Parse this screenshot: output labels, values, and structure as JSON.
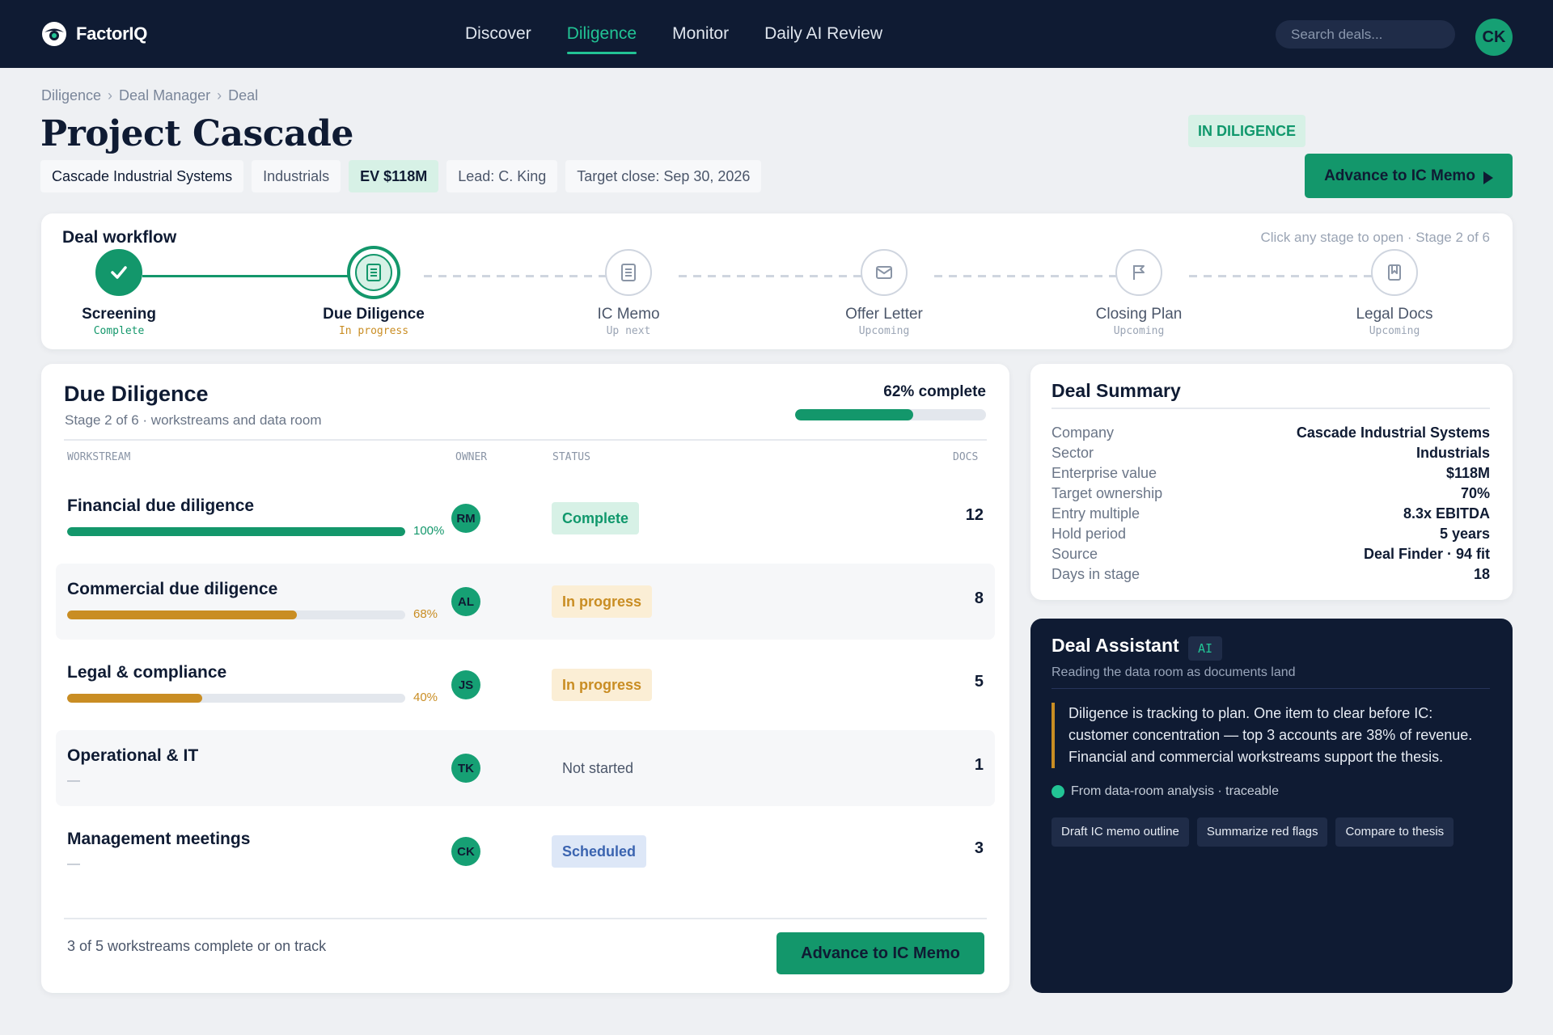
{
  "app": {
    "name": "FactorIQ",
    "nav": [
      "Discover",
      "Diligence",
      "Monitor",
      "Daily AI Review"
    ],
    "search_placeholder": "Search deals...",
    "user_initials": "CK"
  },
  "breadcrumb": [
    "Diligence",
    "Deal Manager",
    "Deal"
  ],
  "deal": {
    "title": "Project Cascade",
    "status": "IN DILIGENCE",
    "company": "Cascade Industrial Systems",
    "sector": "Industrials",
    "ev": "EV $118M",
    "lead": "Lead: C. King",
    "target_close": "Target close: Sep 30, 2026",
    "advance_label": "Advance to IC Memo"
  },
  "workflow": {
    "title": "Deal workflow",
    "hint": "Click any stage to open · Stage 2 of 6",
    "stages": [
      {
        "name": "Screening",
        "status": "Complete",
        "icon": "check-icon"
      },
      {
        "name": "Due Diligence",
        "status": "In progress",
        "icon": "document-icon"
      },
      {
        "name": "IC Memo",
        "status": "Up next",
        "icon": "document-icon"
      },
      {
        "name": "Offer Letter",
        "status": "Upcoming",
        "icon": "envelope-icon"
      },
      {
        "name": "Closing Plan",
        "status": "Upcoming",
        "icon": "flag-icon"
      },
      {
        "name": "Legal Docs",
        "status": "Upcoming",
        "icon": "bookmark-icon"
      }
    ]
  },
  "due_diligence": {
    "title": "Due Diligence",
    "subtitle": "Stage 2 of 6 · workstreams and data room",
    "percent_label": "62% complete",
    "percent": 62,
    "columns": {
      "workstream": "WORKSTREAM",
      "owner": "OWNER",
      "status": "STATUS",
      "docs": "DOCS"
    },
    "rows": [
      {
        "name": "Financial due diligence",
        "progress": 100,
        "progress_label": "100%",
        "owner": "RM",
        "status": "Complete",
        "docs": "12"
      },
      {
        "name": "Commercial due diligence",
        "progress": 68,
        "progress_label": "68%",
        "owner": "AL",
        "status": "In progress",
        "docs": "8"
      },
      {
        "name": "Legal & compliance",
        "progress": 40,
        "progress_label": "40%",
        "owner": "JS",
        "status": "In progress",
        "docs": "5"
      },
      {
        "name": "Operational & IT",
        "progress": null,
        "progress_label": "—",
        "owner": "TK",
        "status": "Not started",
        "docs": "1"
      },
      {
        "name": "Management meetings",
        "progress": null,
        "progress_label": "—",
        "owner": "CK",
        "status": "Scheduled",
        "docs": "3"
      }
    ],
    "footer": "3 of 5 workstreams complete or on track",
    "advance_label": "Advance to IC Memo"
  },
  "summary": {
    "title": "Deal Summary",
    "rows": [
      {
        "label": "Company",
        "value": "Cascade Industrial Systems"
      },
      {
        "label": "Sector",
        "value": "Industrials"
      },
      {
        "label": "Enterprise value",
        "value": "$118M"
      },
      {
        "label": "Target ownership",
        "value": "70%"
      },
      {
        "label": "Entry multiple",
        "value": "8.3x EBITDA"
      },
      {
        "label": "Hold period",
        "value": "5 years"
      },
      {
        "label": "Source",
        "value": "Deal Finder · 94 fit"
      },
      {
        "label": "Days in stage",
        "value": "18"
      }
    ]
  },
  "assistant": {
    "title": "Deal Assistant",
    "badge": "AI",
    "subtitle": "Reading the data room as documents land",
    "message": "Diligence is tracking to plan. One item to clear before IC: customer concentration — top 3 accounts are 38% of revenue. Financial and commercial workstreams support the thesis.",
    "source": "From data-room analysis · traceable",
    "actions": [
      "Draft IC memo outline",
      "Summarize red flags",
      "Compare to thesis"
    ]
  },
  "colors": {
    "navy": "#0f1b33",
    "green": "#13976b",
    "amber": "#c98d23",
    "blue": "#3b64b0"
  }
}
